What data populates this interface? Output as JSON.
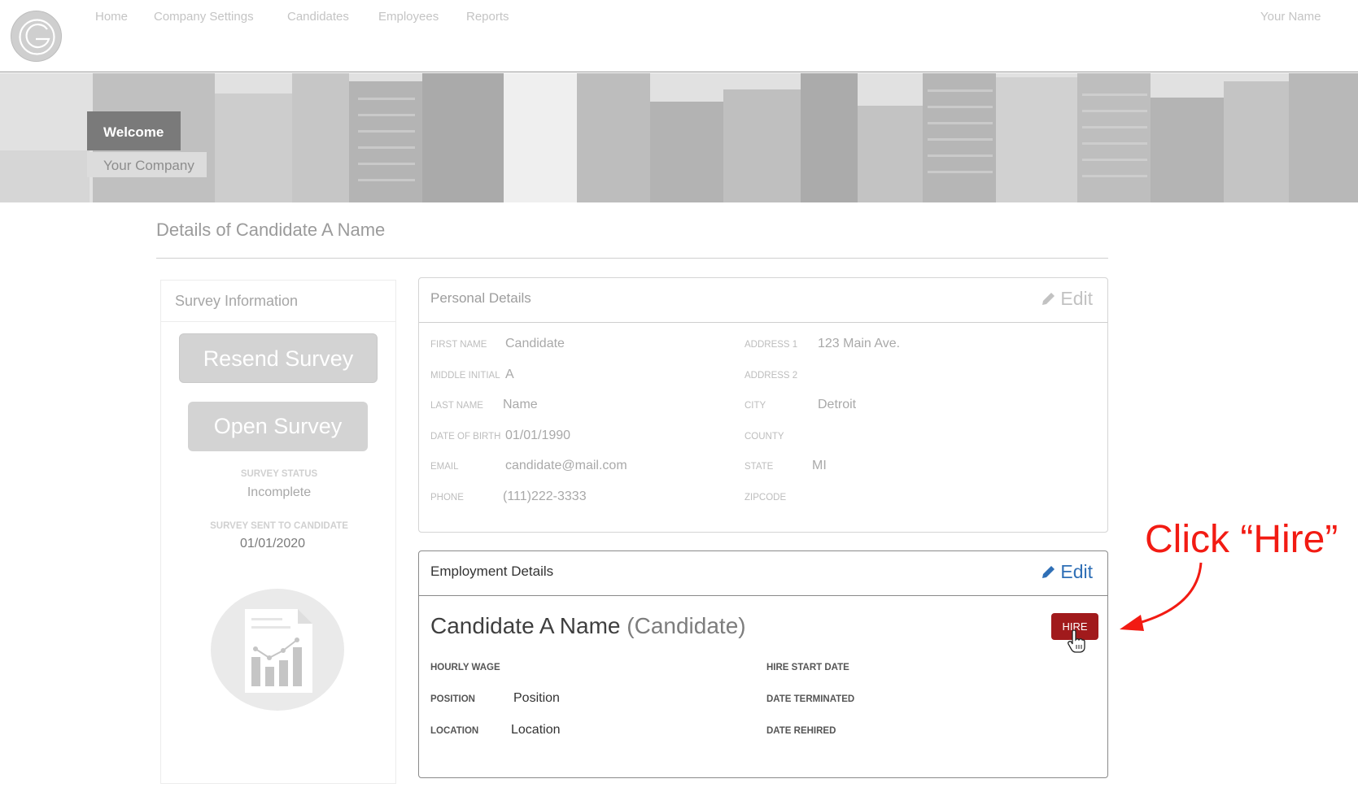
{
  "nav": {
    "items": [
      "Home",
      "Company Settings",
      "Candidates",
      "Employees",
      "Reports"
    ],
    "user_name": "Your Name"
  },
  "banner": {
    "welcome": "Welcome",
    "company": "Your Company"
  },
  "page": {
    "title": "Details of Candidate A Name"
  },
  "survey": {
    "heading": "Survey Information",
    "resend_label": "Resend Survey",
    "open_label": "Open Survey",
    "status_label": "SURVEY STATUS",
    "status_value": "Incomplete",
    "sent_label": "SURVEY SENT TO CANDIDATE",
    "sent_value": "01/01/2020"
  },
  "personal": {
    "heading": "Personal Details",
    "edit_label": "Edit",
    "fields_left": [
      {
        "label": "FIRST NAME",
        "value": "Candidate"
      },
      {
        "label": "MIDDLE INITIAL",
        "value": "A"
      },
      {
        "label": "LAST NAME",
        "value": "Name"
      },
      {
        "label": "DATE OF BIRTH",
        "value": "01/01/1990"
      },
      {
        "label": "EMAIL",
        "value": "candidate@mail.com"
      },
      {
        "label": "PHONE",
        "value": "(111)222-3333"
      }
    ],
    "fields_right": [
      {
        "label": "ADDRESS 1",
        "value": "123 Main Ave."
      },
      {
        "label": "ADDRESS 2",
        "value": ""
      },
      {
        "label": "CITY",
        "value": "Detroit"
      },
      {
        "label": "COUNTY",
        "value": ""
      },
      {
        "label": "STATE",
        "value": "MI"
      },
      {
        "label": "ZIPCODE",
        "value": ""
      }
    ]
  },
  "employment": {
    "heading": "Employment Details",
    "edit_label": "Edit",
    "candidate_name": "Candidate A Name",
    "candidate_role": "(Candidate)",
    "hire_label": "HIRE",
    "fields_left": [
      {
        "label": "HOURLY WAGE",
        "value": ""
      },
      {
        "label": "POSITION",
        "value": "Position"
      },
      {
        "label": "LOCATION",
        "value": "Location"
      }
    ],
    "fields_right": [
      {
        "label": "HIRE START DATE",
        "value": ""
      },
      {
        "label": "DATE TERMINATED",
        "value": ""
      },
      {
        "label": "DATE REHIRED",
        "value": ""
      }
    ]
  },
  "annotation": {
    "callout": "Click “Hire”"
  },
  "icons": {
    "logo": "company-logo",
    "edit": "pencil-icon",
    "cursor": "hand-pointer-icon",
    "report": "report-chart-icon"
  },
  "colors": {
    "hire_button": "#a11a1c",
    "edit_active": "#2f6fb6",
    "callout": "#f21b13"
  }
}
